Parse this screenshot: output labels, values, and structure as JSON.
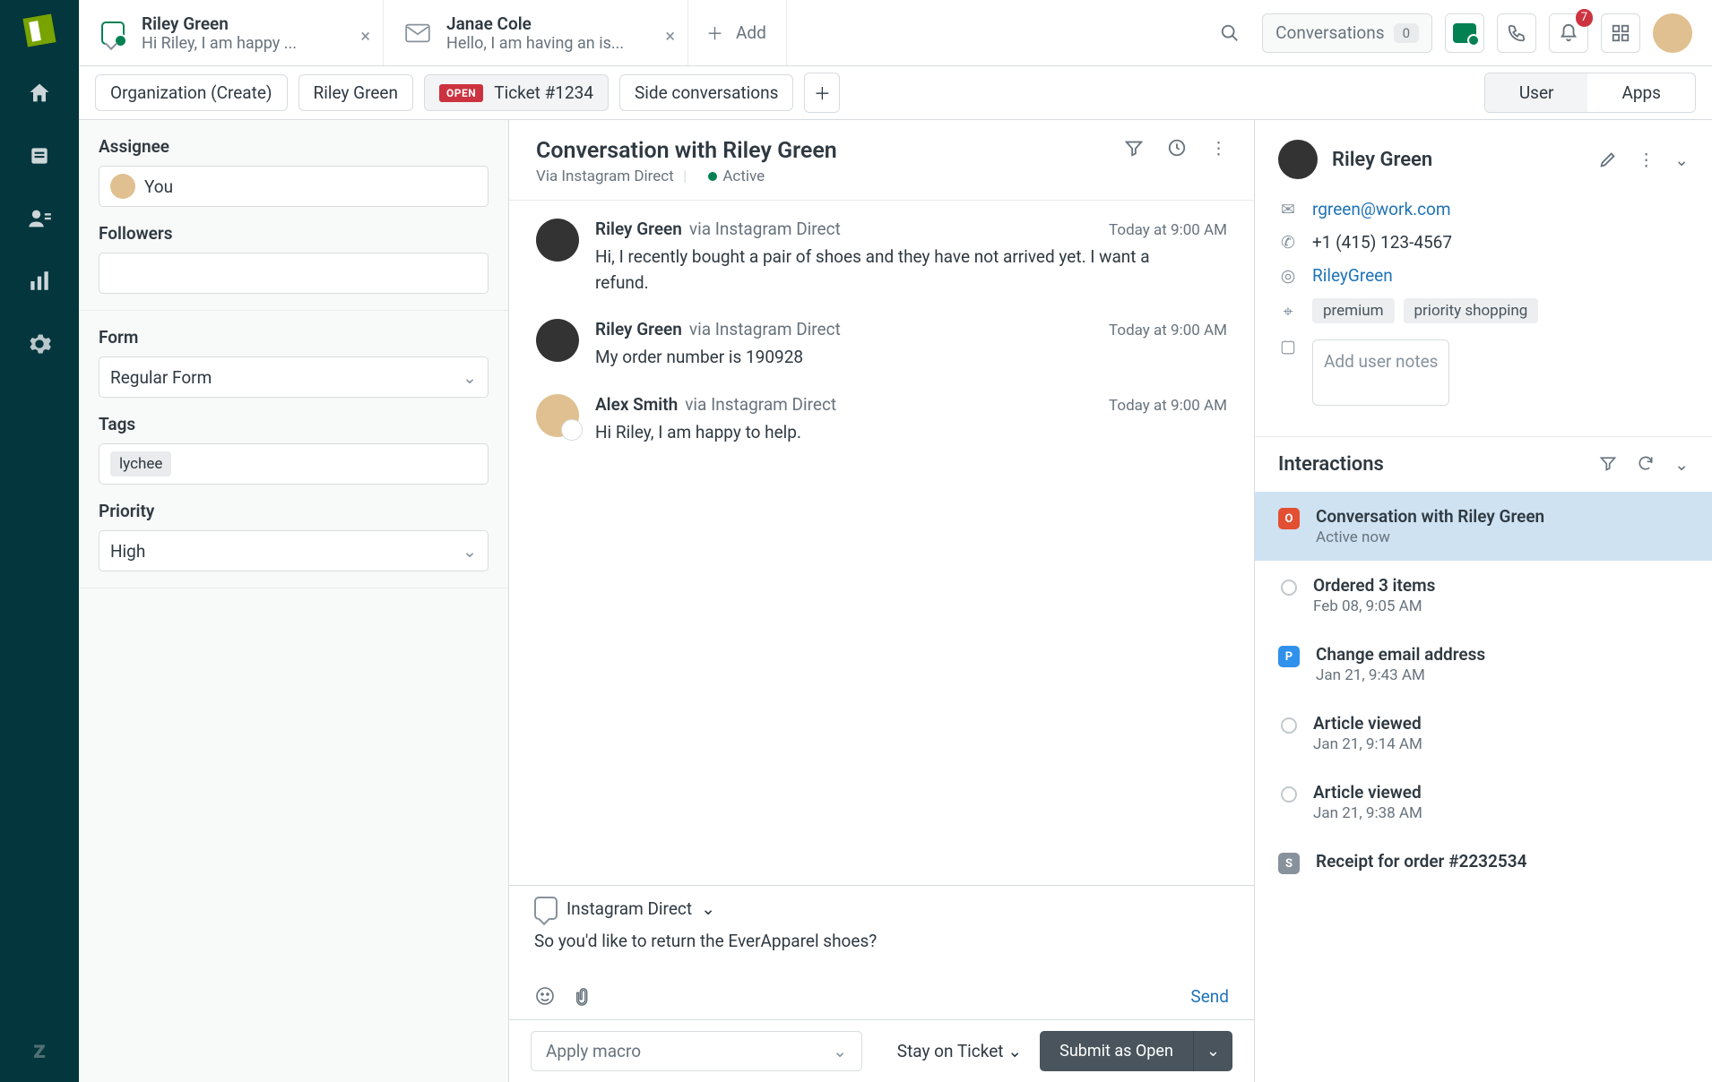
{
  "tabs": [
    {
      "title": "Riley Green",
      "preview": "Hi Riley, I am happy ...",
      "icon": "chat"
    },
    {
      "title": "Janae Cole",
      "preview": "Hello, I am having an is...",
      "icon": "mail"
    }
  ],
  "add_tab": "Add",
  "top": {
    "conversations": "Conversations",
    "conv_count": "0",
    "notif_count": "7"
  },
  "crumbs": {
    "org": "Organization (Create)",
    "person": "Riley Green",
    "open": "OPEN",
    "ticket": "Ticket #1234",
    "side": "Side conversations"
  },
  "rtabs": {
    "user": "User",
    "apps": "Apps"
  },
  "sidebar": {
    "assignee_label": "Assignee",
    "assignee_value": "You",
    "followers_label": "Followers",
    "form_label": "Form",
    "form_value": "Regular Form",
    "tags_label": "Tags",
    "tag": "lychee",
    "priority_label": "Priority",
    "priority_value": "High"
  },
  "convo": {
    "title": "Conversation with Riley Green",
    "via": "Via Instagram Direct",
    "status": "Active",
    "messages": [
      {
        "name": "Riley Green",
        "via": "via Instagram Direct",
        "time": "Today at 9:00 AM",
        "body": "Hi, I recently bought a pair of shoes and they have not arrived yet. I want a refund.",
        "agent": false
      },
      {
        "name": "Riley Green",
        "via": "via Instagram Direct",
        "time": "Today at 9:00 AM",
        "body": "My order number is 190928",
        "agent": false
      },
      {
        "name": "Alex Smith",
        "via": "via Instagram Direct",
        "time": "Today at 9:00 AM",
        "body": "Hi Riley, I am happy to help.",
        "agent": true
      }
    ],
    "compose_channel": "Instagram Direct",
    "compose_text": "So you'd like to return the EverApparel shoes?",
    "send": "Send",
    "macro": "Apply macro",
    "stay": "Stay on Ticket",
    "submit": "Submit as Open"
  },
  "user": {
    "name": "Riley Green",
    "email": "rgreen@work.com",
    "phone": "+1 (415) 123-4567",
    "ig": "RileyGreen",
    "tags": [
      "premium",
      "priority shopping"
    ],
    "notes_placeholder": "Add user notes"
  },
  "interactions": {
    "title": "Interactions",
    "items": [
      {
        "kind": "o",
        "title": "Conversation with Riley Green",
        "sub": "Active now",
        "sel": true
      },
      {
        "kind": "h",
        "title": "Ordered 3 items",
        "sub": "Feb 08, 9:05 AM"
      },
      {
        "kind": "p",
        "title": "Change email address",
        "sub": "Jan 21, 9:43 AM"
      },
      {
        "kind": "h",
        "title": "Article viewed",
        "sub": "Jan 21, 9:14 AM"
      },
      {
        "kind": "h",
        "title": "Article viewed",
        "sub": "Jan 21, 9:38 AM"
      },
      {
        "kind": "s",
        "title": "Receipt for order #2232534",
        "sub": ""
      }
    ]
  }
}
